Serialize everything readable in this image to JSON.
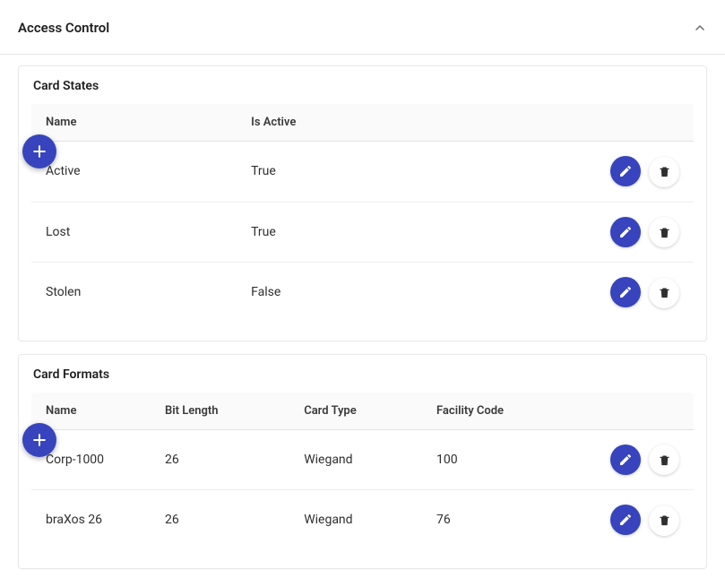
{
  "header": {
    "title": "Access Control"
  },
  "colors": {
    "accent": "#3744be"
  },
  "cardStates": {
    "title": "Card States",
    "columns": [
      "Name",
      "Is Active",
      ""
    ],
    "rows": [
      {
        "name": "Active",
        "isActive": "True"
      },
      {
        "name": "Lost",
        "isActive": "True"
      },
      {
        "name": "Stolen",
        "isActive": "False"
      }
    ]
  },
  "cardFormats": {
    "title": "Card Formats",
    "columns": [
      "Name",
      "Bit Length",
      "Card Type",
      "Facility Code",
      ""
    ],
    "rows": [
      {
        "name": "Corp-1000",
        "bitLength": "26",
        "cardType": "Wiegand",
        "facilityCode": "100"
      },
      {
        "name": "braXos 26",
        "bitLength": "26",
        "cardType": "Wiegand",
        "facilityCode": "76"
      }
    ]
  }
}
